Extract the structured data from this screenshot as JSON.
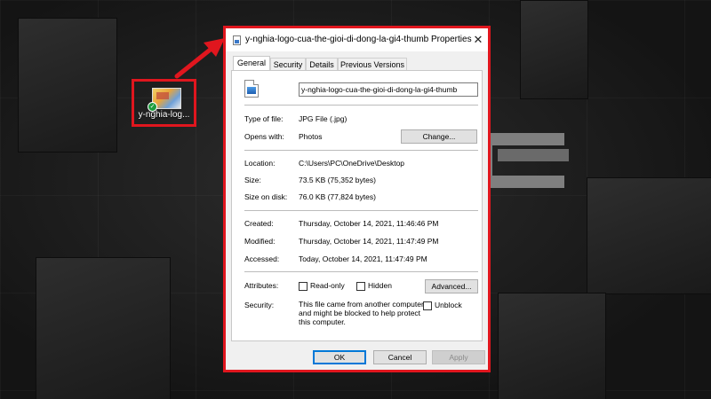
{
  "desktop": {
    "icon_label": "y-nghia-log..."
  },
  "dialog": {
    "title": "y-nghia-logo-cua-the-gioi-di-dong-la-gi4-thumb Properties",
    "close_glyph": "✕",
    "tabs": [
      {
        "label": "General"
      },
      {
        "label": "Security"
      },
      {
        "label": "Details"
      },
      {
        "label": "Previous Versions"
      }
    ],
    "filename": "y-nghia-logo-cua-the-gioi-di-dong-la-gi4-thumb",
    "type_label": "Type of file:",
    "type_value": "JPG File (.jpg)",
    "opens_label": "Opens with:",
    "opens_value": "Photos",
    "change_button": "Change...",
    "location_label": "Location:",
    "location_value": "C:\\Users\\PC\\OneDrive\\Desktop",
    "size_label": "Size:",
    "size_value": "73.5 KB (75,352 bytes)",
    "size_disk_label": "Size on disk:",
    "size_disk_value": "76.0 KB (77,824 bytes)",
    "created_label": "Created:",
    "created_value": "Thursday, October 14, 2021, 11:46:46 PM",
    "modified_label": "Modified:",
    "modified_value": "Thursday, October 14, 2021, 11:47:49 PM",
    "accessed_label": "Accessed:",
    "accessed_value": "Today, October 14, 2021, 11:47:49 PM",
    "attributes_label": "Attributes:",
    "readonly_label": "Read-only",
    "hidden_label": "Hidden",
    "advanced_button": "Advanced...",
    "security_label": "Security:",
    "security_lines": [
      "This file came from another computer",
      "and might be blocked to help protect",
      "this computer."
    ],
    "unblock_label": "Unblock",
    "ok_button": "OK",
    "cancel_button": "Cancel",
    "apply_button": "Apply"
  },
  "colors": {
    "highlight": "#e0161e",
    "accent": "#0078d7"
  },
  "icons": [
    "image-file-icon",
    "red-arrow-icon",
    "close-icon",
    "sync-check-icon"
  ]
}
